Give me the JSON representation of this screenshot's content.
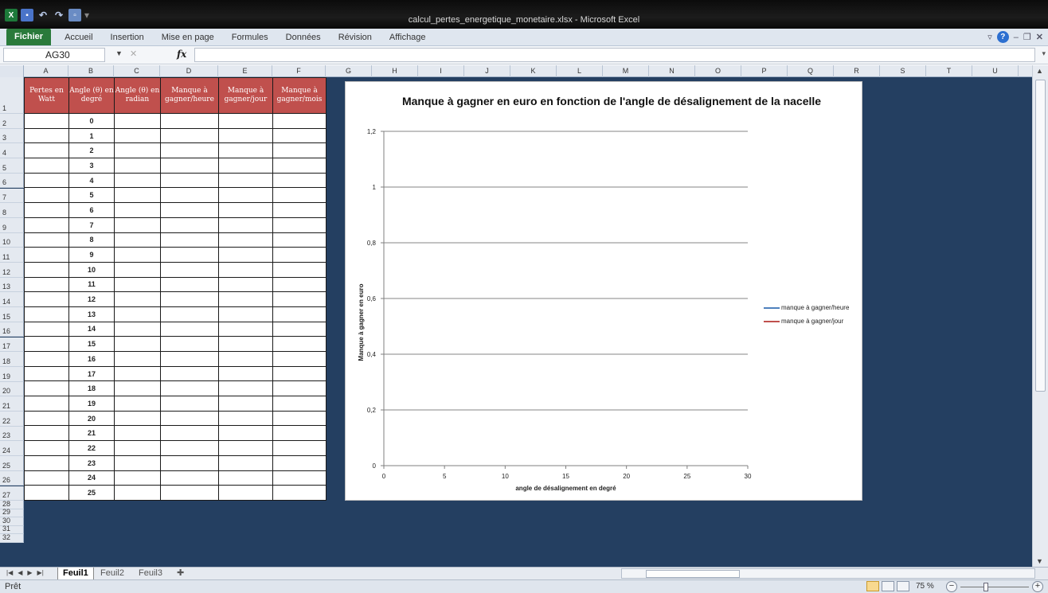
{
  "window": {
    "title": "calcul_pertes_energetique_monetaire.xlsx - Microsoft Excel"
  },
  "qat": {
    "app_icon": "excel-icon",
    "save_icon": "save-icon",
    "undo_icon": "undo-icon",
    "redo_icon": "redo-icon"
  },
  "ribbon": {
    "file_tab": "Fichier",
    "tabs": [
      "Accueil",
      "Insertion",
      "Mise en page",
      "Formules",
      "Données",
      "Révision",
      "Affichage"
    ]
  },
  "formula_bar": {
    "name_box": "AG30",
    "fx_label": "fx",
    "formula": ""
  },
  "columns": [
    "A",
    "B",
    "C",
    "D",
    "E",
    "F",
    "G",
    "H",
    "I",
    "J",
    "K",
    "L",
    "M",
    "N",
    "O",
    "P",
    "Q",
    "R",
    "S",
    "T",
    "U"
  ],
  "table": {
    "headers": [
      "Pertes en Watt",
      "Angle (θ) en degré",
      "Angle (θ) en radian",
      "Manque à gagner/heure",
      "Manque à gagner/jour",
      "Manque à gagner/mois"
    ],
    "angles": [
      "0",
      "1",
      "2",
      "3",
      "4",
      "5",
      "6",
      "7",
      "8",
      "9",
      "10",
      "11",
      "12",
      "13",
      "14",
      "15",
      "16",
      "17",
      "18",
      "19",
      "20",
      "21",
      "22",
      "23",
      "24",
      "25"
    ]
  },
  "rows": [
    "1",
    "2",
    "3",
    "4",
    "5",
    "6",
    "7",
    "8",
    "9",
    "10",
    "11",
    "12",
    "13",
    "14",
    "15",
    "16",
    "17",
    "18",
    "19",
    "20",
    "21",
    "22",
    "23",
    "24",
    "25",
    "26",
    "27",
    "28",
    "29",
    "30",
    "31",
    "32"
  ],
  "chart_data": {
    "type": "line",
    "title": "Manque à gagner en euro en fonction de l'angle de désalignement de la nacelle",
    "xlabel": "angle de désalignement  en degré",
    "ylabel": "Manque à gagner en euro",
    "xlim": [
      0,
      30
    ],
    "ylim": [
      0,
      1.2
    ],
    "x_ticks": [
      "0",
      "5",
      "10",
      "15",
      "20",
      "25",
      "30"
    ],
    "y_ticks": [
      "0",
      "0,2",
      "0,4",
      "0,6",
      "0,8",
      "1",
      "1,2"
    ],
    "grid": "horizontal",
    "legend_position": "right",
    "series": [
      {
        "name": "manque à gagner/heure",
        "color": "#4f81bd",
        "values": []
      },
      {
        "name": "manque à gagner/jour",
        "color": "#c0504d",
        "values": []
      }
    ]
  },
  "sheets": [
    "Feuil1",
    "Feuil2",
    "Feuil3"
  ],
  "status": {
    "ready": "Prêt",
    "zoom": "75 %"
  }
}
